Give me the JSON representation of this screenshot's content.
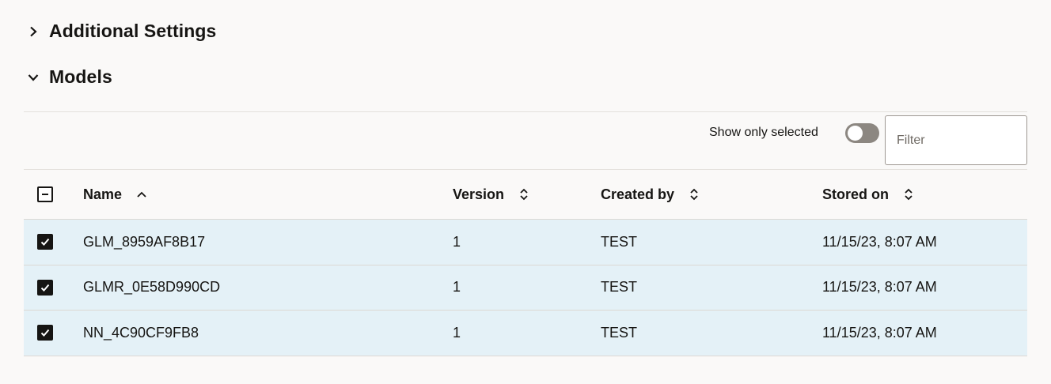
{
  "sections": {
    "additional": {
      "title": "Additional Settings",
      "expanded": false
    },
    "models": {
      "title": "Models",
      "expanded": true
    }
  },
  "toolbar": {
    "show_only_selected_label": "Show only selected",
    "show_only_selected_on": false,
    "filter_placeholder": "Filter"
  },
  "table": {
    "columns": [
      {
        "label": "Name",
        "sort": "ascending"
      },
      {
        "label": "Version",
        "sort": "none"
      },
      {
        "label": "Created by",
        "sort": "none"
      },
      {
        "label": "Stored on",
        "sort": "none"
      }
    ],
    "select_all_state": "mixed",
    "rows": [
      {
        "name": "GLM_8959AF8B17",
        "version": "1",
        "created_by": "TEST",
        "stored_on": "11/15/23, 8:07 AM",
        "selected": true
      },
      {
        "name": "GLMR_0E58D990CD",
        "version": "1",
        "created_by": "TEST",
        "stored_on": "11/15/23, 8:07 AM",
        "selected": true
      },
      {
        "name": "NN_4C90CF9FB8",
        "version": "1",
        "created_by": "TEST",
        "stored_on": "11/15/23, 8:07 AM",
        "selected": true
      }
    ]
  },
  "colors": {
    "background": "#faf9f8",
    "selected_row": "#e4f1f7",
    "text": "#161513",
    "toggle_off": "#8c8781"
  }
}
